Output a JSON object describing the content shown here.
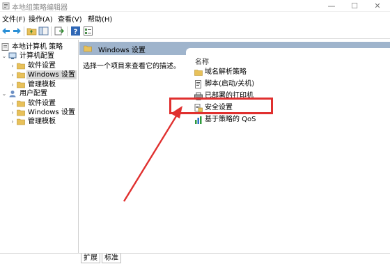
{
  "window": {
    "title": "本地组策略编辑器",
    "minimize": "—",
    "maximize": "☐",
    "close": "✕"
  },
  "menubar": {
    "items": [
      {
        "label": "文件(F)"
      },
      {
        "label": "操作(A)"
      },
      {
        "label": "查看(V)"
      },
      {
        "label": "帮助(H)"
      }
    ]
  },
  "tree": {
    "root": "本地计算机 策略",
    "computer": {
      "label": "计算机配置",
      "children": [
        "软件设置",
        "Windows 设置",
        "管理模板"
      ]
    },
    "user": {
      "label": "用户配置",
      "children": [
        "软件设置",
        "Windows 设置",
        "管理模板"
      ]
    }
  },
  "content": {
    "header_title": "Windows 设置",
    "description": "选择一个项目来查看它的描述。",
    "column_name": "名称",
    "items": [
      "域名解析策略",
      "脚本(启动/关机)",
      "已部署的打印机",
      "安全设置",
      "基于策略的 QoS"
    ]
  },
  "bottom_tabs": [
    "扩展",
    "标准"
  ],
  "colors": {
    "header": "#9fb4cc",
    "highlight": "#e0302f",
    "selection": "#d9d9d9",
    "folder": "#e8c15a"
  }
}
